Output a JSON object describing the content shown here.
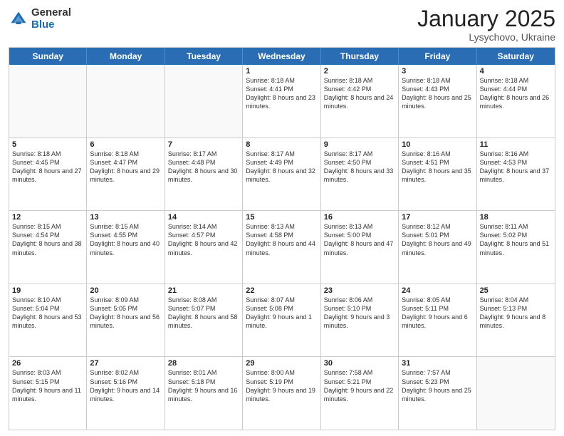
{
  "header": {
    "logo_general": "General",
    "logo_blue": "Blue",
    "month_title": "January 2025",
    "location": "Lysychovo, Ukraine"
  },
  "weekdays": [
    "Sunday",
    "Monday",
    "Tuesday",
    "Wednesday",
    "Thursday",
    "Friday",
    "Saturday"
  ],
  "weeks": [
    [
      {
        "day": "",
        "sunrise": "",
        "sunset": "",
        "daylight": ""
      },
      {
        "day": "",
        "sunrise": "",
        "sunset": "",
        "daylight": ""
      },
      {
        "day": "",
        "sunrise": "",
        "sunset": "",
        "daylight": ""
      },
      {
        "day": "1",
        "sunrise": "Sunrise: 8:18 AM",
        "sunset": "Sunset: 4:41 PM",
        "daylight": "Daylight: 8 hours and 23 minutes."
      },
      {
        "day": "2",
        "sunrise": "Sunrise: 8:18 AM",
        "sunset": "Sunset: 4:42 PM",
        "daylight": "Daylight: 8 hours and 24 minutes."
      },
      {
        "day": "3",
        "sunrise": "Sunrise: 8:18 AM",
        "sunset": "Sunset: 4:43 PM",
        "daylight": "Daylight: 8 hours and 25 minutes."
      },
      {
        "day": "4",
        "sunrise": "Sunrise: 8:18 AM",
        "sunset": "Sunset: 4:44 PM",
        "daylight": "Daylight: 8 hours and 26 minutes."
      }
    ],
    [
      {
        "day": "5",
        "sunrise": "Sunrise: 8:18 AM",
        "sunset": "Sunset: 4:45 PM",
        "daylight": "Daylight: 8 hours and 27 minutes."
      },
      {
        "day": "6",
        "sunrise": "Sunrise: 8:18 AM",
        "sunset": "Sunset: 4:47 PM",
        "daylight": "Daylight: 8 hours and 29 minutes."
      },
      {
        "day": "7",
        "sunrise": "Sunrise: 8:17 AM",
        "sunset": "Sunset: 4:48 PM",
        "daylight": "Daylight: 8 hours and 30 minutes."
      },
      {
        "day": "8",
        "sunrise": "Sunrise: 8:17 AM",
        "sunset": "Sunset: 4:49 PM",
        "daylight": "Daylight: 8 hours and 32 minutes."
      },
      {
        "day": "9",
        "sunrise": "Sunrise: 8:17 AM",
        "sunset": "Sunset: 4:50 PM",
        "daylight": "Daylight: 8 hours and 33 minutes."
      },
      {
        "day": "10",
        "sunrise": "Sunrise: 8:16 AM",
        "sunset": "Sunset: 4:51 PM",
        "daylight": "Daylight: 8 hours and 35 minutes."
      },
      {
        "day": "11",
        "sunrise": "Sunrise: 8:16 AM",
        "sunset": "Sunset: 4:53 PM",
        "daylight": "Daylight: 8 hours and 37 minutes."
      }
    ],
    [
      {
        "day": "12",
        "sunrise": "Sunrise: 8:15 AM",
        "sunset": "Sunset: 4:54 PM",
        "daylight": "Daylight: 8 hours and 38 minutes."
      },
      {
        "day": "13",
        "sunrise": "Sunrise: 8:15 AM",
        "sunset": "Sunset: 4:55 PM",
        "daylight": "Daylight: 8 hours and 40 minutes."
      },
      {
        "day": "14",
        "sunrise": "Sunrise: 8:14 AM",
        "sunset": "Sunset: 4:57 PM",
        "daylight": "Daylight: 8 hours and 42 minutes."
      },
      {
        "day": "15",
        "sunrise": "Sunrise: 8:13 AM",
        "sunset": "Sunset: 4:58 PM",
        "daylight": "Daylight: 8 hours and 44 minutes."
      },
      {
        "day": "16",
        "sunrise": "Sunrise: 8:13 AM",
        "sunset": "Sunset: 5:00 PM",
        "daylight": "Daylight: 8 hours and 47 minutes."
      },
      {
        "day": "17",
        "sunrise": "Sunrise: 8:12 AM",
        "sunset": "Sunset: 5:01 PM",
        "daylight": "Daylight: 8 hours and 49 minutes."
      },
      {
        "day": "18",
        "sunrise": "Sunrise: 8:11 AM",
        "sunset": "Sunset: 5:02 PM",
        "daylight": "Daylight: 8 hours and 51 minutes."
      }
    ],
    [
      {
        "day": "19",
        "sunrise": "Sunrise: 8:10 AM",
        "sunset": "Sunset: 5:04 PM",
        "daylight": "Daylight: 8 hours and 53 minutes."
      },
      {
        "day": "20",
        "sunrise": "Sunrise: 8:09 AM",
        "sunset": "Sunset: 5:05 PM",
        "daylight": "Daylight: 8 hours and 56 minutes."
      },
      {
        "day": "21",
        "sunrise": "Sunrise: 8:08 AM",
        "sunset": "Sunset: 5:07 PM",
        "daylight": "Daylight: 8 hours and 58 minutes."
      },
      {
        "day": "22",
        "sunrise": "Sunrise: 8:07 AM",
        "sunset": "Sunset: 5:08 PM",
        "daylight": "Daylight: 9 hours and 1 minute."
      },
      {
        "day": "23",
        "sunrise": "Sunrise: 8:06 AM",
        "sunset": "Sunset: 5:10 PM",
        "daylight": "Daylight: 9 hours and 3 minutes."
      },
      {
        "day": "24",
        "sunrise": "Sunrise: 8:05 AM",
        "sunset": "Sunset: 5:11 PM",
        "daylight": "Daylight: 9 hours and 6 minutes."
      },
      {
        "day": "25",
        "sunrise": "Sunrise: 8:04 AM",
        "sunset": "Sunset: 5:13 PM",
        "daylight": "Daylight: 9 hours and 8 minutes."
      }
    ],
    [
      {
        "day": "26",
        "sunrise": "Sunrise: 8:03 AM",
        "sunset": "Sunset: 5:15 PM",
        "daylight": "Daylight: 9 hours and 11 minutes."
      },
      {
        "day": "27",
        "sunrise": "Sunrise: 8:02 AM",
        "sunset": "Sunset: 5:16 PM",
        "daylight": "Daylight: 9 hours and 14 minutes."
      },
      {
        "day": "28",
        "sunrise": "Sunrise: 8:01 AM",
        "sunset": "Sunset: 5:18 PM",
        "daylight": "Daylight: 9 hours and 16 minutes."
      },
      {
        "day": "29",
        "sunrise": "Sunrise: 8:00 AM",
        "sunset": "Sunset: 5:19 PM",
        "daylight": "Daylight: 9 hours and 19 minutes."
      },
      {
        "day": "30",
        "sunrise": "Sunrise: 7:58 AM",
        "sunset": "Sunset: 5:21 PM",
        "daylight": "Daylight: 9 hours and 22 minutes."
      },
      {
        "day": "31",
        "sunrise": "Sunrise: 7:57 AM",
        "sunset": "Sunset: 5:23 PM",
        "daylight": "Daylight: 9 hours and 25 minutes."
      },
      {
        "day": "",
        "sunrise": "",
        "sunset": "",
        "daylight": ""
      }
    ]
  ]
}
